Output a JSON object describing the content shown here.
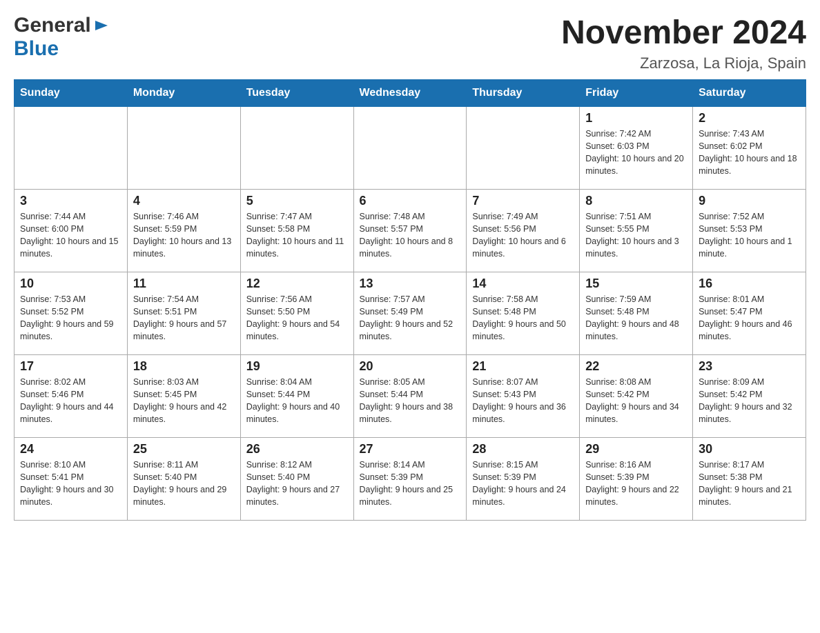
{
  "logo": {
    "general": "General",
    "blue": "Blue",
    "arrow_symbol": "▶"
  },
  "title": "November 2024",
  "subtitle": "Zarzosa, La Rioja, Spain",
  "days_of_week": [
    "Sunday",
    "Monday",
    "Tuesday",
    "Wednesday",
    "Thursday",
    "Friday",
    "Saturday"
  ],
  "weeks": [
    [
      {
        "day": "",
        "sunrise": "",
        "sunset": "",
        "daylight": ""
      },
      {
        "day": "",
        "sunrise": "",
        "sunset": "",
        "daylight": ""
      },
      {
        "day": "",
        "sunrise": "",
        "sunset": "",
        "daylight": ""
      },
      {
        "day": "",
        "sunrise": "",
        "sunset": "",
        "daylight": ""
      },
      {
        "day": "",
        "sunrise": "",
        "sunset": "",
        "daylight": ""
      },
      {
        "day": "1",
        "sunrise": "Sunrise: 7:42 AM",
        "sunset": "Sunset: 6:03 PM",
        "daylight": "Daylight: 10 hours and 20 minutes."
      },
      {
        "day": "2",
        "sunrise": "Sunrise: 7:43 AM",
        "sunset": "Sunset: 6:02 PM",
        "daylight": "Daylight: 10 hours and 18 minutes."
      }
    ],
    [
      {
        "day": "3",
        "sunrise": "Sunrise: 7:44 AM",
        "sunset": "Sunset: 6:00 PM",
        "daylight": "Daylight: 10 hours and 15 minutes."
      },
      {
        "day": "4",
        "sunrise": "Sunrise: 7:46 AM",
        "sunset": "Sunset: 5:59 PM",
        "daylight": "Daylight: 10 hours and 13 minutes."
      },
      {
        "day": "5",
        "sunrise": "Sunrise: 7:47 AM",
        "sunset": "Sunset: 5:58 PM",
        "daylight": "Daylight: 10 hours and 11 minutes."
      },
      {
        "day": "6",
        "sunrise": "Sunrise: 7:48 AM",
        "sunset": "Sunset: 5:57 PM",
        "daylight": "Daylight: 10 hours and 8 minutes."
      },
      {
        "day": "7",
        "sunrise": "Sunrise: 7:49 AM",
        "sunset": "Sunset: 5:56 PM",
        "daylight": "Daylight: 10 hours and 6 minutes."
      },
      {
        "day": "8",
        "sunrise": "Sunrise: 7:51 AM",
        "sunset": "Sunset: 5:55 PM",
        "daylight": "Daylight: 10 hours and 3 minutes."
      },
      {
        "day": "9",
        "sunrise": "Sunrise: 7:52 AM",
        "sunset": "Sunset: 5:53 PM",
        "daylight": "Daylight: 10 hours and 1 minute."
      }
    ],
    [
      {
        "day": "10",
        "sunrise": "Sunrise: 7:53 AM",
        "sunset": "Sunset: 5:52 PM",
        "daylight": "Daylight: 9 hours and 59 minutes."
      },
      {
        "day": "11",
        "sunrise": "Sunrise: 7:54 AM",
        "sunset": "Sunset: 5:51 PM",
        "daylight": "Daylight: 9 hours and 57 minutes."
      },
      {
        "day": "12",
        "sunrise": "Sunrise: 7:56 AM",
        "sunset": "Sunset: 5:50 PM",
        "daylight": "Daylight: 9 hours and 54 minutes."
      },
      {
        "day": "13",
        "sunrise": "Sunrise: 7:57 AM",
        "sunset": "Sunset: 5:49 PM",
        "daylight": "Daylight: 9 hours and 52 minutes."
      },
      {
        "day": "14",
        "sunrise": "Sunrise: 7:58 AM",
        "sunset": "Sunset: 5:48 PM",
        "daylight": "Daylight: 9 hours and 50 minutes."
      },
      {
        "day": "15",
        "sunrise": "Sunrise: 7:59 AM",
        "sunset": "Sunset: 5:48 PM",
        "daylight": "Daylight: 9 hours and 48 minutes."
      },
      {
        "day": "16",
        "sunrise": "Sunrise: 8:01 AM",
        "sunset": "Sunset: 5:47 PM",
        "daylight": "Daylight: 9 hours and 46 minutes."
      }
    ],
    [
      {
        "day": "17",
        "sunrise": "Sunrise: 8:02 AM",
        "sunset": "Sunset: 5:46 PM",
        "daylight": "Daylight: 9 hours and 44 minutes."
      },
      {
        "day": "18",
        "sunrise": "Sunrise: 8:03 AM",
        "sunset": "Sunset: 5:45 PM",
        "daylight": "Daylight: 9 hours and 42 minutes."
      },
      {
        "day": "19",
        "sunrise": "Sunrise: 8:04 AM",
        "sunset": "Sunset: 5:44 PM",
        "daylight": "Daylight: 9 hours and 40 minutes."
      },
      {
        "day": "20",
        "sunrise": "Sunrise: 8:05 AM",
        "sunset": "Sunset: 5:44 PM",
        "daylight": "Daylight: 9 hours and 38 minutes."
      },
      {
        "day": "21",
        "sunrise": "Sunrise: 8:07 AM",
        "sunset": "Sunset: 5:43 PM",
        "daylight": "Daylight: 9 hours and 36 minutes."
      },
      {
        "day": "22",
        "sunrise": "Sunrise: 8:08 AM",
        "sunset": "Sunset: 5:42 PM",
        "daylight": "Daylight: 9 hours and 34 minutes."
      },
      {
        "day": "23",
        "sunrise": "Sunrise: 8:09 AM",
        "sunset": "Sunset: 5:42 PM",
        "daylight": "Daylight: 9 hours and 32 minutes."
      }
    ],
    [
      {
        "day": "24",
        "sunrise": "Sunrise: 8:10 AM",
        "sunset": "Sunset: 5:41 PM",
        "daylight": "Daylight: 9 hours and 30 minutes."
      },
      {
        "day": "25",
        "sunrise": "Sunrise: 8:11 AM",
        "sunset": "Sunset: 5:40 PM",
        "daylight": "Daylight: 9 hours and 29 minutes."
      },
      {
        "day": "26",
        "sunrise": "Sunrise: 8:12 AM",
        "sunset": "Sunset: 5:40 PM",
        "daylight": "Daylight: 9 hours and 27 minutes."
      },
      {
        "day": "27",
        "sunrise": "Sunrise: 8:14 AM",
        "sunset": "Sunset: 5:39 PM",
        "daylight": "Daylight: 9 hours and 25 minutes."
      },
      {
        "day": "28",
        "sunrise": "Sunrise: 8:15 AM",
        "sunset": "Sunset: 5:39 PM",
        "daylight": "Daylight: 9 hours and 24 minutes."
      },
      {
        "day": "29",
        "sunrise": "Sunrise: 8:16 AM",
        "sunset": "Sunset: 5:39 PM",
        "daylight": "Daylight: 9 hours and 22 minutes."
      },
      {
        "day": "30",
        "sunrise": "Sunrise: 8:17 AM",
        "sunset": "Sunset: 5:38 PM",
        "daylight": "Daylight: 9 hours and 21 minutes."
      }
    ]
  ]
}
